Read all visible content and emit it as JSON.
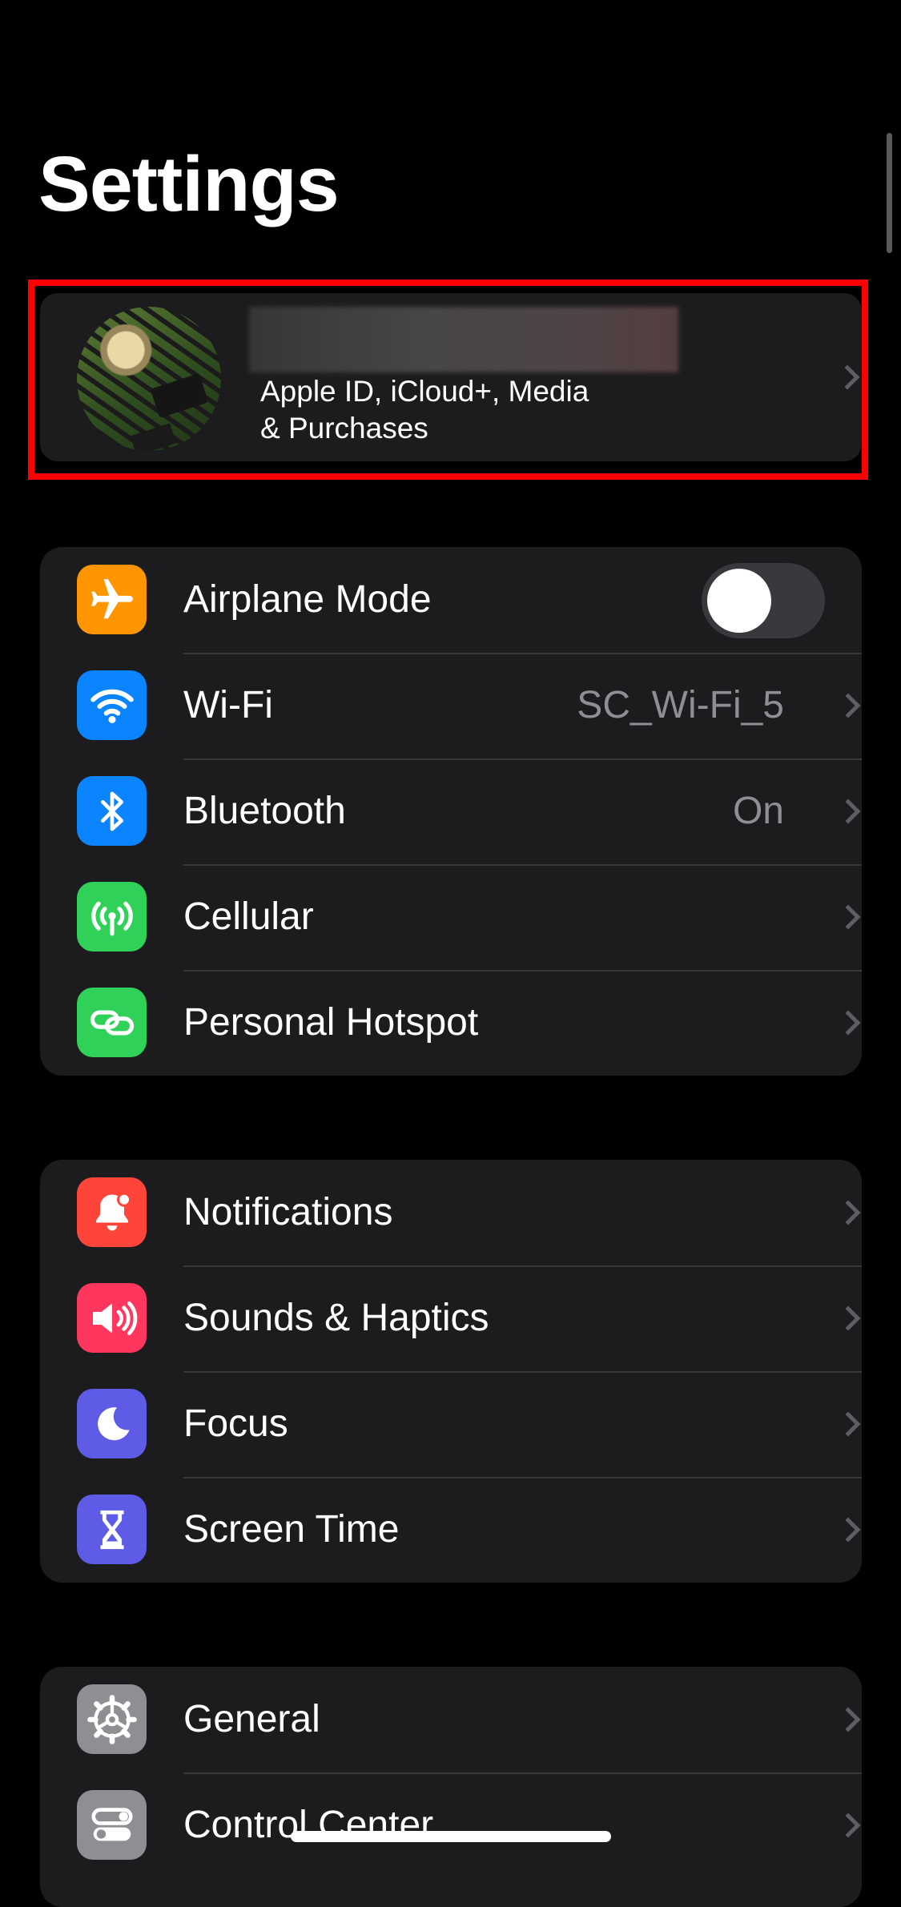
{
  "title": "Settings",
  "profile": {
    "subtitle_line1": "Apple ID, iCloud+, Media",
    "subtitle_line2": "& Purchases"
  },
  "connectivity": [
    {
      "label": "Airplane Mode",
      "icon": "airplane-icon",
      "color": "#ff9500",
      "toggle": false
    },
    {
      "label": "Wi-Fi",
      "icon": "wifi-icon",
      "color": "#0a84ff",
      "value": "SC_Wi-Fi_5"
    },
    {
      "label": "Bluetooth",
      "icon": "bluetooth-icon",
      "color": "#0a84ff",
      "value": "On"
    },
    {
      "label": "Cellular",
      "icon": "cellular-antenna-icon",
      "color": "#30d158"
    },
    {
      "label": "Personal Hotspot",
      "icon": "hotspot-link-icon",
      "color": "#30d158"
    }
  ],
  "alerts": [
    {
      "label": "Notifications",
      "icon": "bell-icon",
      "color": "#ff453a"
    },
    {
      "label": "Sounds & Haptics",
      "icon": "speaker-icon",
      "color": "#ff375f"
    },
    {
      "label": "Focus",
      "icon": "moon-icon",
      "color": "#5e5ce6"
    },
    {
      "label": "Screen Time",
      "icon": "hourglass-icon",
      "color": "#5e5ce6"
    }
  ],
  "system": [
    {
      "label": "General",
      "icon": "gear-icon",
      "color": "#8e8e93"
    },
    {
      "label": "Control Center",
      "icon": "switches-icon",
      "color": "#8e8e93"
    }
  ]
}
